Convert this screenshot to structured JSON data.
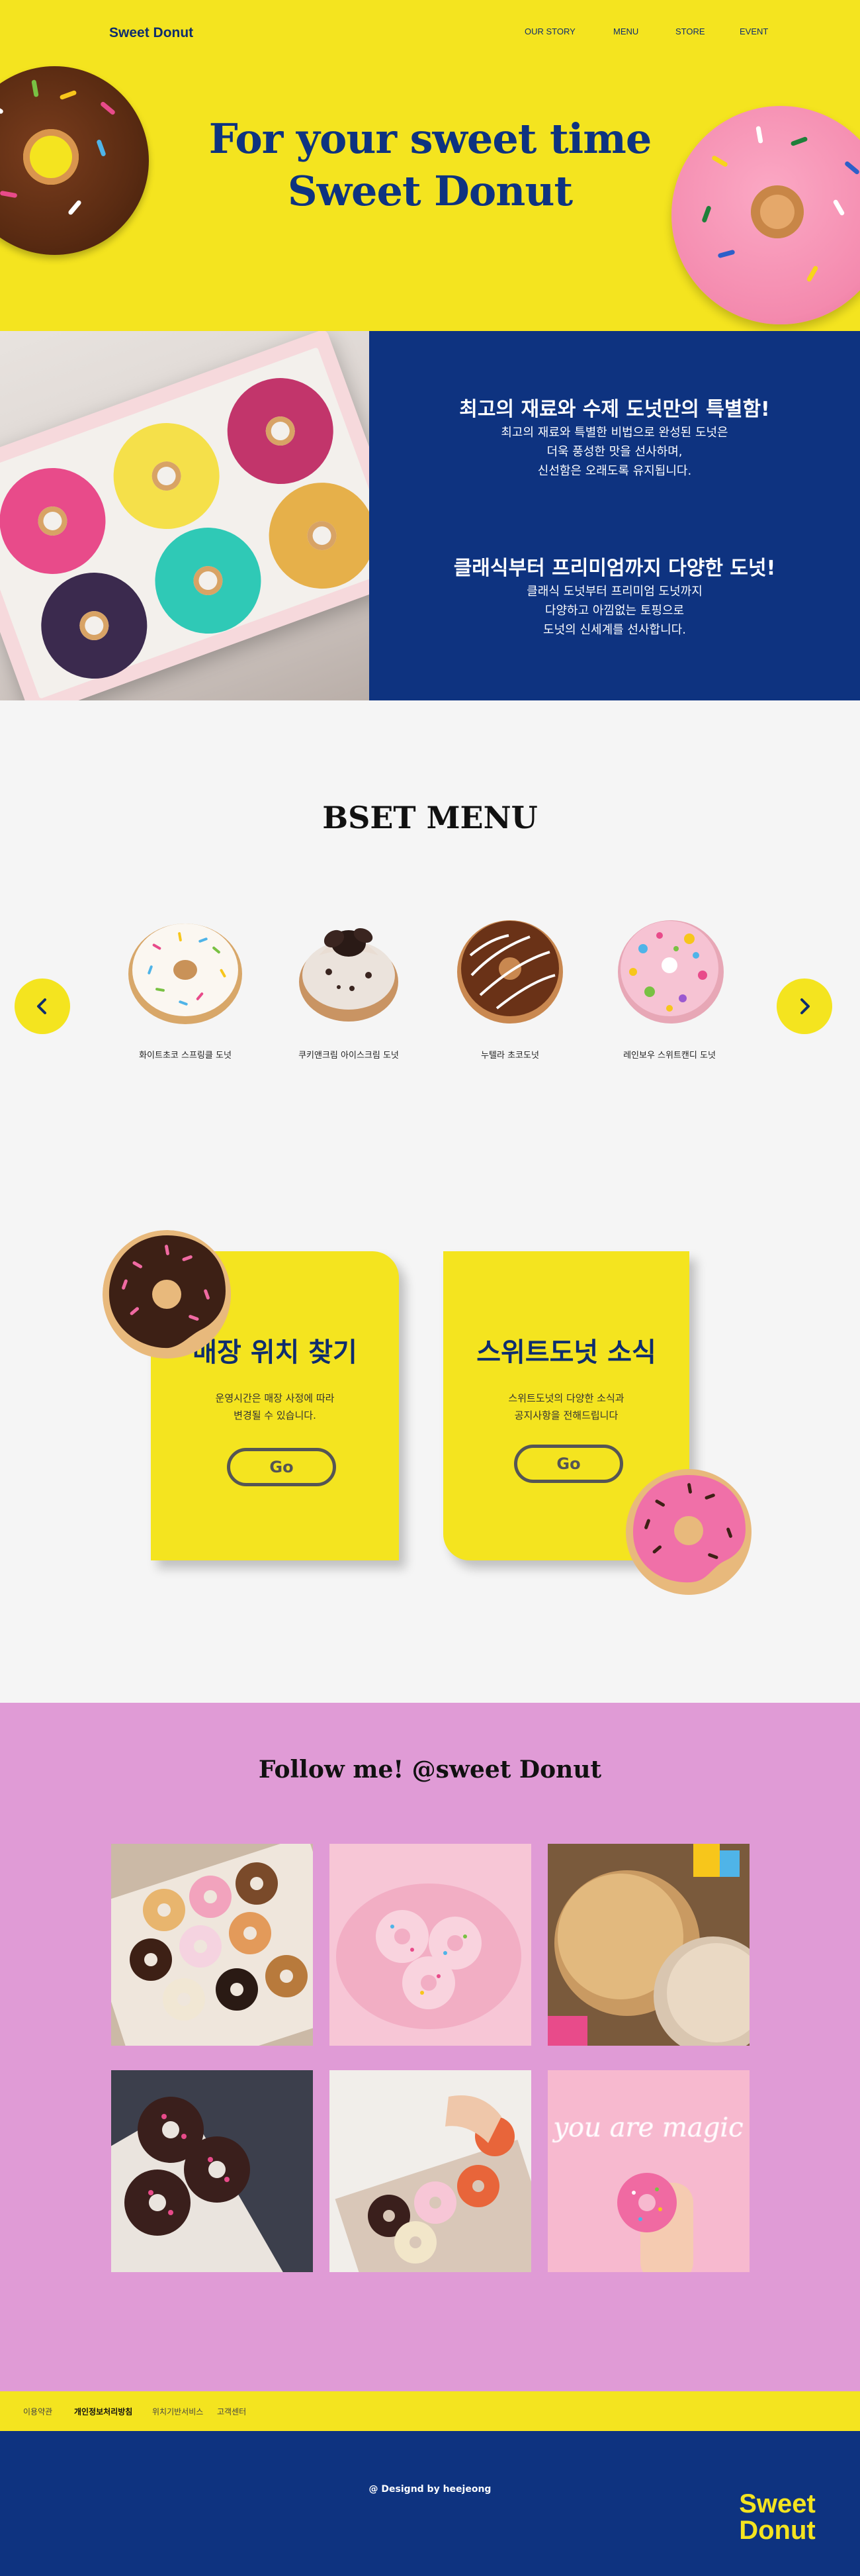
{
  "header": {
    "logo": "Sweet Donut",
    "nav": [
      "OUR STORY",
      "MENU",
      "STORE",
      "EVENT"
    ]
  },
  "hero": {
    "line1": "For your sweet time",
    "line2": "Sweet Donut"
  },
  "features": [
    {
      "title": "최고의 재료와 수제 도넛만의 특별함!",
      "lines": [
        "최고의 재료와 특별한 비법으로 완성된 도넛은",
        "더욱 풍성한 맛을 선사하며,",
        "신선함은 오래도록 유지됩니다."
      ]
    },
    {
      "title": "클래식부터 프리미엄까지 다양한 도넛!",
      "lines": [
        "클래식 도넛부터 프리미엄 도넛까지",
        "다양하고 아낌없는 토핑으로",
        "도넛의 신세계를 선사합니다."
      ]
    }
  ],
  "best_menu": {
    "title": "BSET MENU",
    "items": [
      "화이트초코 스프링클 도넛",
      "쿠키앤크림 아이스크림 도넛",
      "누텔라 초코도넛",
      "레인보우 스위트캔디 도넛"
    ]
  },
  "cards": [
    {
      "title": "매장 위치 찾기",
      "lines": [
        "운영시간은 매장 사정에 따라",
        "변경될 수 있습니다."
      ],
      "button": "Go"
    },
    {
      "title": "스위트도넛 소식",
      "lines": [
        "스위트도넛의 다양한 소식과",
        "공지사항을 전해드립니다"
      ],
      "button": "Go"
    }
  ],
  "instagram": {
    "title": "Follow me! @sweet Donut",
    "neon_text": "you are magic"
  },
  "footer": {
    "links": [
      "이용약관",
      "개인정보처리방침",
      "위치기반서비스",
      "고객센터"
    ],
    "credit": "@ Designd by heejeong",
    "logo_line1": "Sweet",
    "logo_line2": "Donut"
  },
  "colors": {
    "yellow": "#f4e41f",
    "navy": "#0e3380",
    "pink_bg": "#e09bd6",
    "light_bg": "#f5f5f5"
  }
}
